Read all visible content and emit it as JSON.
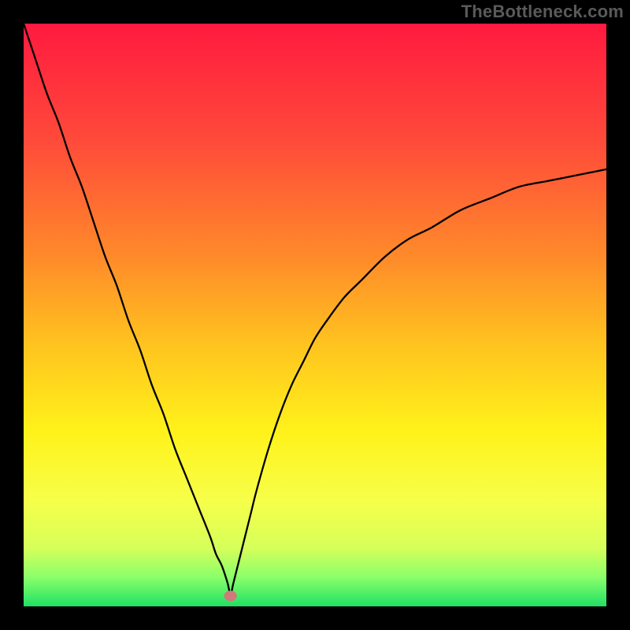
{
  "watermark": "TheBottleneck.com",
  "chart_data": {
    "type": "line",
    "title": "",
    "xlabel": "",
    "ylabel": "",
    "xlim": [
      0,
      100
    ],
    "ylim": [
      0,
      100
    ],
    "grid": false,
    "notch": {
      "x": 35.5,
      "y": 1.5
    },
    "series": [
      {
        "name": "curve",
        "x": [
          0,
          2,
          4,
          6,
          8,
          10,
          12,
          14,
          16,
          18,
          20,
          22,
          24,
          26,
          28,
          30,
          32,
          33,
          34,
          35,
          35.5,
          36,
          37,
          38,
          39,
          40,
          42,
          44,
          46,
          48,
          50,
          52,
          55,
          58,
          62,
          66,
          70,
          75,
          80,
          85,
          90,
          95,
          100
        ],
        "y": [
          100,
          94,
          88,
          83,
          77,
          72,
          66,
          60,
          55,
          49,
          44,
          38,
          33,
          27,
          22,
          17,
          12,
          9,
          7,
          4,
          2,
          4,
          8,
          12,
          16,
          20,
          27,
          33,
          38,
          42,
          46,
          49,
          53,
          56,
          60,
          63,
          65,
          68,
          70,
          72,
          73,
          74,
          75
        ]
      }
    ],
    "background_gradient": {
      "stops": [
        {
          "offset": 0.0,
          "color": "#ff1a3f"
        },
        {
          "offset": 0.2,
          "color": "#ff4a3a"
        },
        {
          "offset": 0.4,
          "color": "#ff8a2a"
        },
        {
          "offset": 0.55,
          "color": "#ffc31f"
        },
        {
          "offset": 0.7,
          "color": "#fff21a"
        },
        {
          "offset": 0.82,
          "color": "#f6ff4a"
        },
        {
          "offset": 0.9,
          "color": "#d6ff5a"
        },
        {
          "offset": 0.95,
          "color": "#8aff6a"
        },
        {
          "offset": 1.0,
          "color": "#20e065"
        }
      ]
    },
    "marker": {
      "x": 35.5,
      "y": 1.8,
      "rx": 1.1,
      "ry": 0.9,
      "fill": "#d07a7a"
    }
  }
}
